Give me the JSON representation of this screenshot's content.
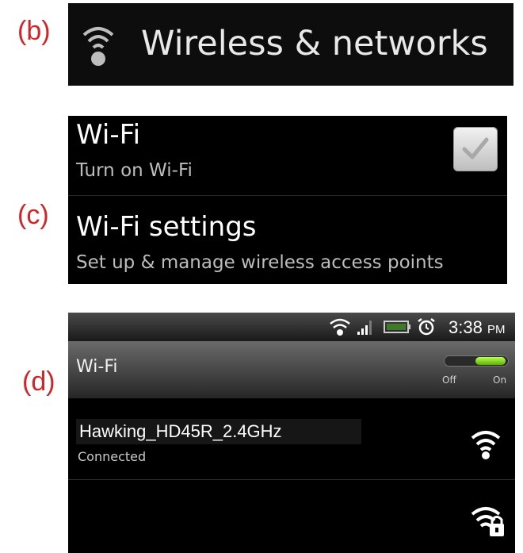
{
  "labels": {
    "b": "(b)",
    "c": "(c)",
    "d": "(d)"
  },
  "panel_b": {
    "title": "Wireless & networks",
    "icon": "wifi-icon"
  },
  "panel_c": {
    "wifi_title": "Wi-Fi",
    "wifi_subtitle": "Turn on Wi-Fi",
    "wifi_checked": true,
    "settings_title": "Wi-Fi settings",
    "settings_subtitle": "Set up & manage wireless access points"
  },
  "panel_d": {
    "status_time": "3:38",
    "status_ampm": "PM",
    "header_title": "Wi-Fi",
    "toggle_off": "Off",
    "toggle_on": "On",
    "toggle_state": "on",
    "networks": [
      {
        "name": "Hawking_HD45R_2.4GHz",
        "status": "Connected",
        "icon": "wifi-signal-icon"
      },
      {
        "name": "",
        "status": "",
        "icon": "wifi-secured-icon"
      }
    ],
    "colors": {
      "accent_green": "#7cd12a",
      "label_red": "#d0262a"
    }
  }
}
